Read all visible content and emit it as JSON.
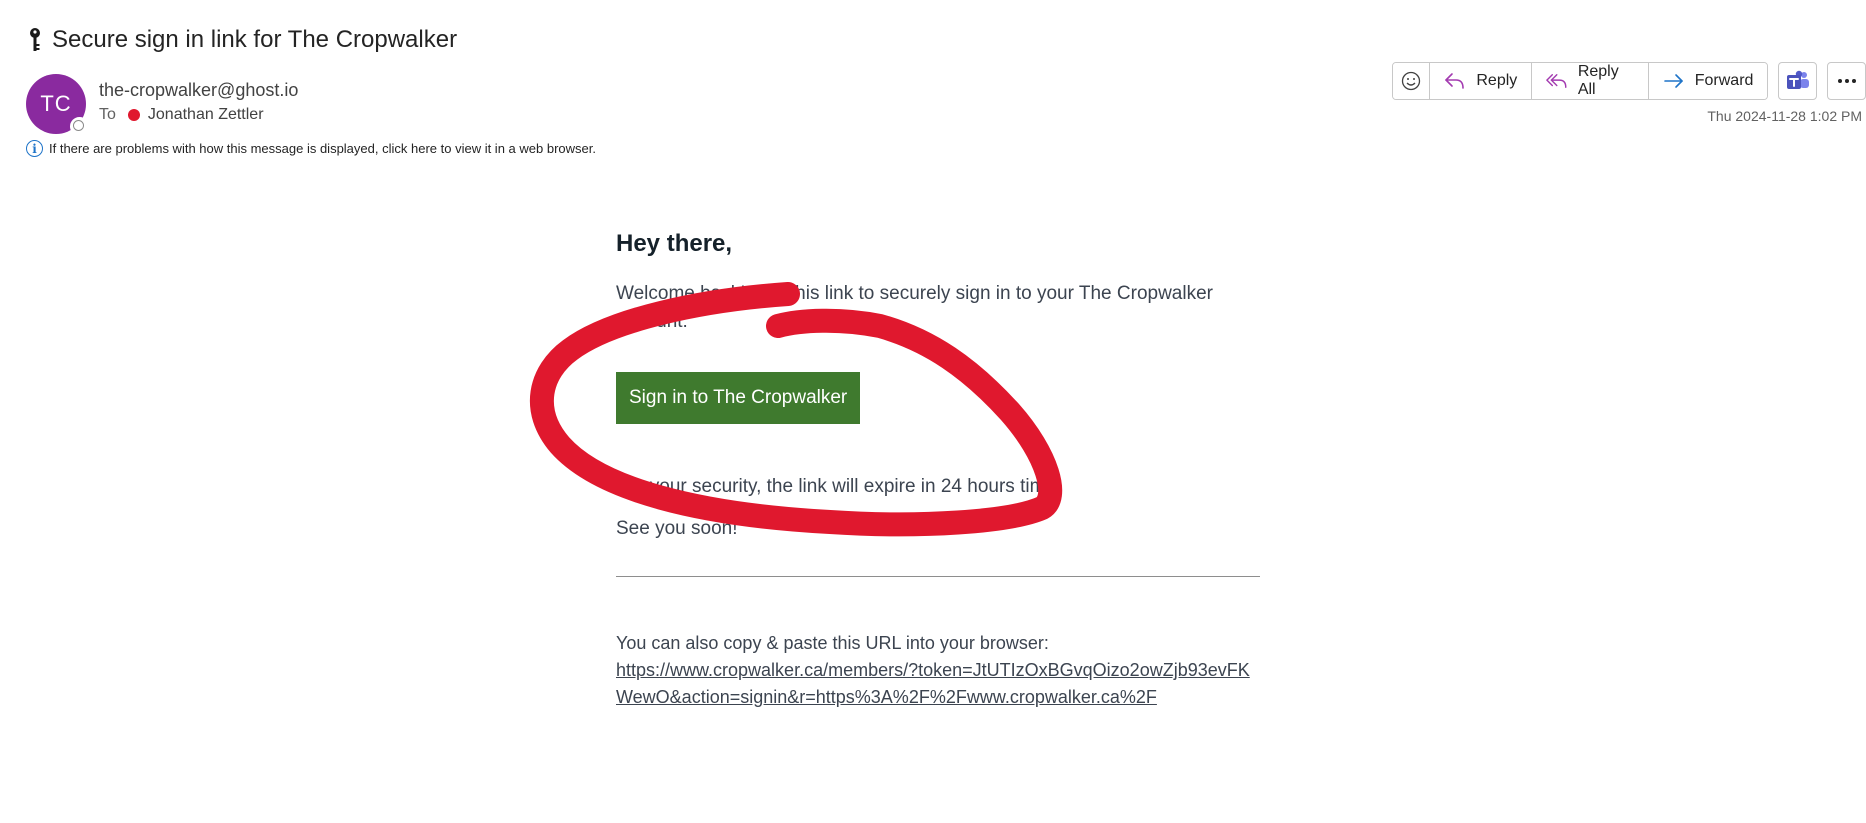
{
  "email": {
    "subject": "Secure sign in link for The Cropwalker",
    "avatar_initials": "TC",
    "sender": "the-cropwalker@ghost.io",
    "to_label": "To",
    "recipient": "Jonathan Zettler",
    "info_notice": "If there are problems with how this message is displayed, click here to view it in a web browser.",
    "timestamp": "Thu 2024-11-28 1:02 PM"
  },
  "toolbar": {
    "reply_label": "Reply",
    "reply_all_label": "Reply All",
    "forward_label": "Forward"
  },
  "body": {
    "greeting": "Hey there,",
    "welcome": "Welcome back! Use this link to securely sign in to your The Cropwalker account:",
    "button_label": "Sign in to The Cropwalker",
    "expire_note": "For your security, the link will expire in 24 hours time.",
    "sign_off": "See you soon!",
    "copy_note": "You can also copy & paste this URL into your browser:",
    "url": "https://www.cropwalker.ca/members/?token=JtUTIzOxBGvqOizo2owZjb93evFKWewO&action=signin&r=https%3A%2F%2Fwww.cropwalker.ca%2F"
  },
  "colors": {
    "avatar": "#8a2a9f",
    "cta_button": "#3f7a2e",
    "annotation": "#e0182e",
    "info_accent": "#1f74c8"
  }
}
